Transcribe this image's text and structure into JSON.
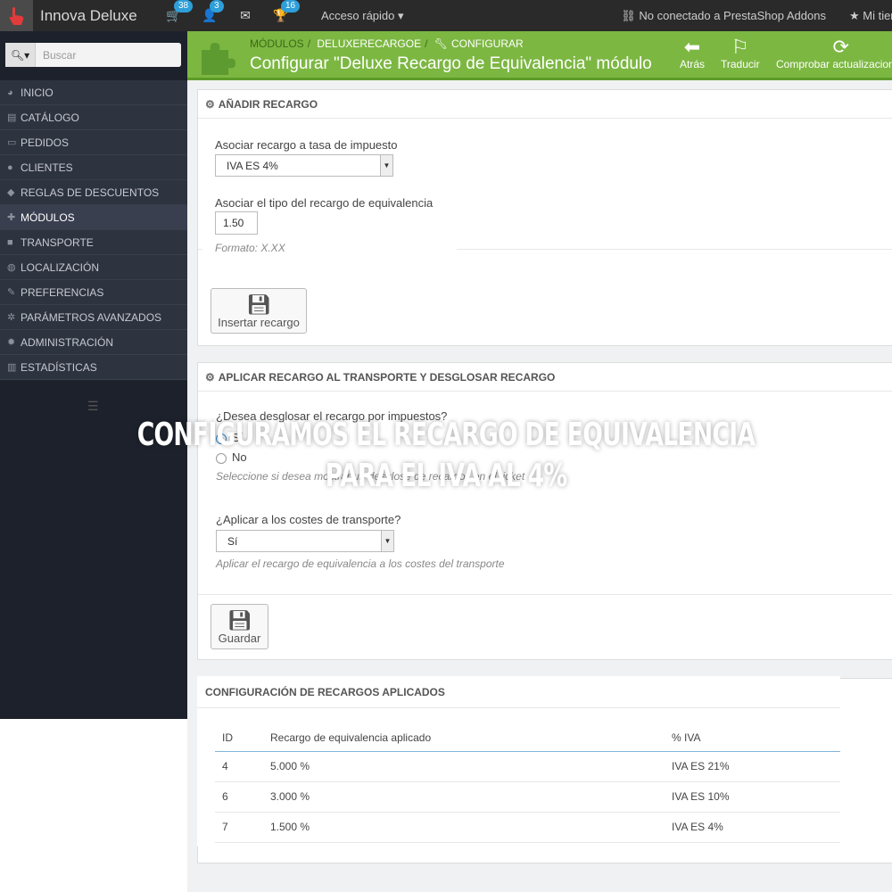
{
  "topbar": {
    "brand": "Innova Deluxe",
    "badges": {
      "orders": "38",
      "customers": "3",
      "messages": "16"
    },
    "quick_access": "Acceso rápido",
    "addons_status": "No conectado a PrestaShop Addons",
    "shop": "Mi tienda"
  },
  "sidebar": {
    "search_placeholder": "Buscar",
    "items": [
      {
        "label": "INICIO",
        "icon": "dashboard-icon"
      },
      {
        "label": "CATÁLOGO",
        "icon": "book-icon"
      },
      {
        "label": "PEDIDOS",
        "icon": "credit-card-icon"
      },
      {
        "label": "CLIENTES",
        "icon": "users-icon"
      },
      {
        "label": "REGLAS DE DESCUENTOS",
        "icon": "tags-icon"
      },
      {
        "label": "MÓDULOS",
        "icon": "puzzle-icon"
      },
      {
        "label": "TRANSPORTE",
        "icon": "truck-icon"
      },
      {
        "label": "LOCALIZACIÓN",
        "icon": "globe-icon"
      },
      {
        "label": "PREFERENCIAS",
        "icon": "wrench-icon"
      },
      {
        "label": "PARÁMETROS AVANZADOS",
        "icon": "cogs-icon"
      },
      {
        "label": "ADMINISTRACIÓN",
        "icon": "cog-icon"
      },
      {
        "label": "ESTADÍSTICAS",
        "icon": "bar-chart-icon"
      }
    ]
  },
  "header": {
    "breadcrumb": [
      "MÓDULOS",
      "DELUXERECARGOE",
      "CONFIGURAR"
    ],
    "title": "Configurar \"Deluxe Recargo de Equivalencia\" módulo",
    "toolbar": {
      "back": "Atrás",
      "translate": "Traducir",
      "update": "Comprobar actualizaciones"
    }
  },
  "add_panel": {
    "heading": "AÑADIR RECARGO",
    "tax_label": "Asociar recargo a tasa de impuesto",
    "tax_value": "IVA ES 4%",
    "rate_label": "Asociar el tipo del recargo de equivalencia",
    "rate_value": "1.50",
    "rate_help": "Formato: X.XX",
    "submit": "Insertar recargo"
  },
  "apply_panel": {
    "heading": "APLICAR RECARGO AL TRANSPORTE Y DESGLOSAR RECARGO",
    "breakdown_label": "¿Desea desglosar el recargo por impuestos?",
    "yes": "Sí",
    "no": "No",
    "breakdown_help": "Seleccione si desea mostrar un desglose de recargos en el ticket",
    "shipping_label": "¿Aplicar a los costes de transporte?",
    "shipping_value": "Sí",
    "shipping_help": "Aplicar el recargo de equivalencia a los costes del transporte",
    "save": "Guardar"
  },
  "table_panel": {
    "heading": "CONFIGURACIÓN DE RECARGOS APLICADOS",
    "columns": [
      "ID",
      "Recargo de equivalencia aplicado",
      "% IVA"
    ],
    "rows": [
      [
        "4",
        "5.000 %",
        "IVA ES 21%"
      ],
      [
        "6",
        "3.000 %",
        "IVA ES 10%"
      ],
      [
        "7",
        "1.500 %",
        "IVA ES 4%"
      ]
    ]
  },
  "overlay": {
    "line1": "CONFIGURAMOS EL RECARGO DE EQUIVALENCIA",
    "line2": "PARA EL IVA AL 4%"
  },
  "colors": {
    "header_green": "#7cb742",
    "sidebar_dark": "#1d212b",
    "badge_blue": "#2e9fd9"
  }
}
